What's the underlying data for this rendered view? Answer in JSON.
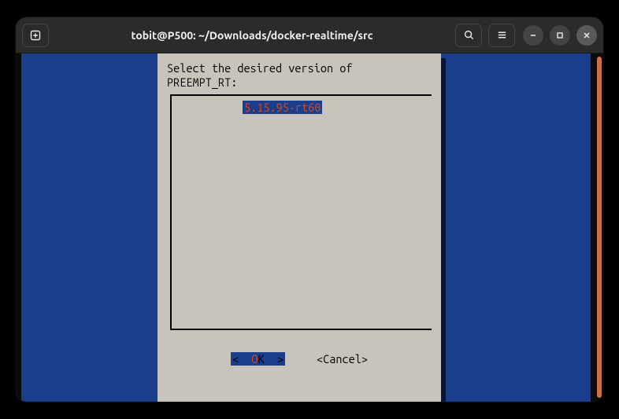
{
  "titlebar": {
    "title": "tobit@P500: ~/Downloads/docker-realtime/src"
  },
  "dialog": {
    "prompt_line1": "Select the desired version of",
    "prompt_line2": "PREEMPT_RT:",
    "selected_item": "5.15.95-rt60",
    "ok_pre": "<  ",
    "ok_hot": "O",
    "ok_rest": "K  >",
    "cancel_label": "<Cancel>"
  }
}
